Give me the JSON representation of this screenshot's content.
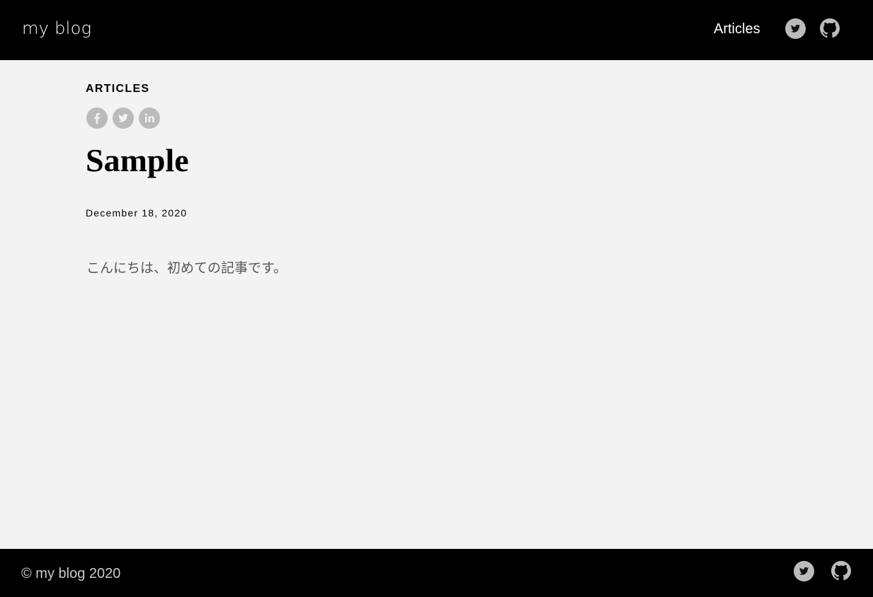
{
  "header": {
    "logo": "my blog",
    "nav": [
      {
        "label": "Articles"
      }
    ],
    "icons": [
      "twitter-icon",
      "github-icon"
    ]
  },
  "article": {
    "category": "ARTICLES",
    "share_icons": [
      "facebook-icon",
      "twitter-icon",
      "linkedin-icon"
    ],
    "title": "Sample",
    "date": "December 18, 2020",
    "body": "こんにちは、初めての記事です。"
  },
  "footer": {
    "copyright": "© my blog 2020",
    "icons": [
      "twitter-icon",
      "github-icon"
    ]
  },
  "colors": {
    "bar": "#000000",
    "background": "#f3f3f3",
    "icon": "#bbbbbb"
  }
}
